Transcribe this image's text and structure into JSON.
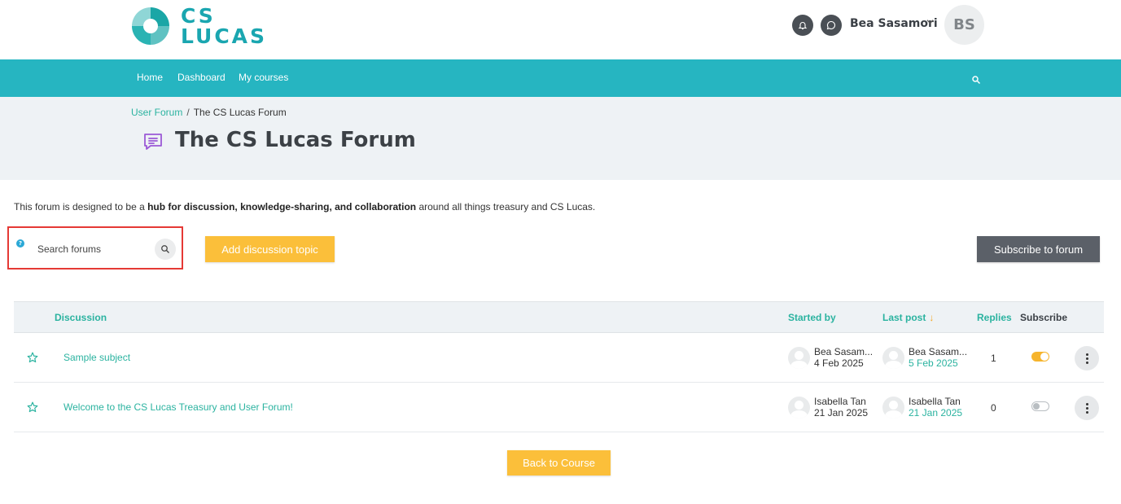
{
  "brand": {
    "logo_line1": "CS",
    "logo_line2": "LUCAS",
    "accent": "#26b5c1"
  },
  "header": {
    "user_name": "Bea Sasamori",
    "avatar_initials": "BS",
    "icons": [
      "bell-icon",
      "chat-icon",
      "chevron-down-icon"
    ]
  },
  "nav": {
    "items": [
      "Home",
      "Dashboard",
      "My courses"
    ],
    "search_icon": "search-icon"
  },
  "breadcrumb": {
    "parent": "User Forum",
    "separator": "/",
    "current": "The CS Lucas Forum"
  },
  "page": {
    "title": "The CS Lucas Forum",
    "icon": "forum-icon"
  },
  "intro": {
    "prefix": "This forum is designed to be a ",
    "bold": "hub for discussion, knowledge-sharing, and collaboration",
    "suffix": " around all things treasury and CS Lucas."
  },
  "search": {
    "placeholder": "Search forums",
    "help": "?"
  },
  "buttons": {
    "add_topic": "Add discussion topic",
    "subscribe": "Subscribe to forum",
    "back": "Back to Course"
  },
  "table": {
    "columns": {
      "discussion": "Discussion",
      "started_by": "Started by",
      "last_post": "Last post",
      "sort_arrow": "↓",
      "replies": "Replies",
      "subscribe": "Subscribe"
    },
    "rows": [
      {
        "subject": "Sample subject",
        "starter": "Bea Sasam...",
        "started": "4 Feb 2025",
        "last_author": "Bea Sasam...",
        "last_date": "5 Feb 2025",
        "replies": "1",
        "subscribed": true
      },
      {
        "subject": "Welcome to the CS Lucas Treasury and User Forum!",
        "starter": "Isabella Tan",
        "started": "21 Jan 2025",
        "last_author": "Isabella Tan",
        "last_date": "21 Jan 2025",
        "replies": "0",
        "subscribed": false
      }
    ]
  }
}
